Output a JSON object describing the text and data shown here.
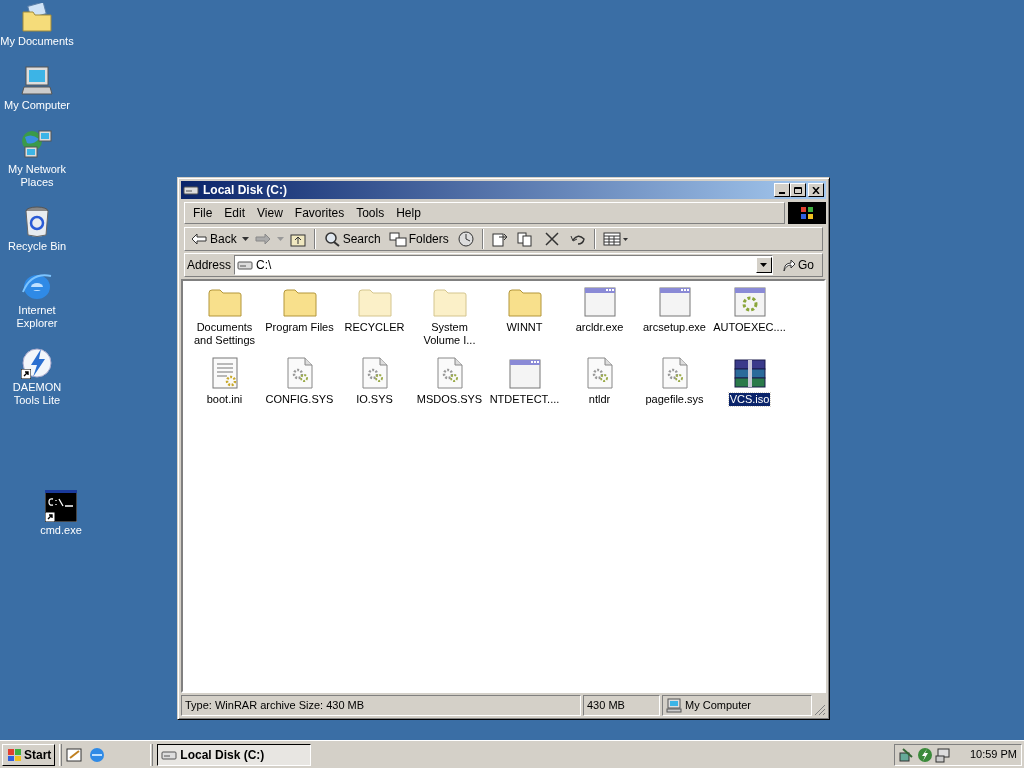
{
  "desktop_icons": [
    {
      "label": "My Documents",
      "kind": "documents"
    },
    {
      "label": "My Computer",
      "kind": "computer"
    },
    {
      "label": "My Network Places",
      "kind": "network"
    },
    {
      "label": "Recycle Bin",
      "kind": "recycle"
    },
    {
      "label": "Internet Explorer",
      "kind": "ie"
    },
    {
      "label": "DAEMON Tools Lite",
      "kind": "daemon",
      "shortcut": true
    }
  ],
  "loose_icon": {
    "label": "cmd.exe",
    "kind": "cmd",
    "shortcut": true
  },
  "window": {
    "title": "Local Disk (C:)",
    "menu": [
      "File",
      "Edit",
      "View",
      "Favorites",
      "Tools",
      "Help"
    ],
    "toolbar": [
      {
        "kind": "back",
        "label": "Back"
      },
      {
        "kind": "forward"
      },
      {
        "kind": "up"
      },
      {
        "kind": "sep"
      },
      {
        "kind": "search",
        "label": "Search"
      },
      {
        "kind": "folders",
        "label": "Folders"
      },
      {
        "kind": "history"
      },
      {
        "kind": "sep"
      },
      {
        "kind": "moveto"
      },
      {
        "kind": "copyto"
      },
      {
        "kind": "delete"
      },
      {
        "kind": "undo"
      },
      {
        "kind": "sep"
      },
      {
        "kind": "views"
      }
    ],
    "address": {
      "label": "Address",
      "value": "C:\\",
      "go": "Go"
    },
    "files": [
      {
        "name": "Documents and Settings",
        "kind": "folder",
        "selected": false
      },
      {
        "name": "Program Files",
        "kind": "folder",
        "selected": false
      },
      {
        "name": "RECYCLER",
        "kind": "hidden-folder",
        "selected": false
      },
      {
        "name": "System Volume I...",
        "kind": "hidden-folder",
        "selected": false
      },
      {
        "name": "WINNT",
        "kind": "folder",
        "selected": false
      },
      {
        "name": "arcldr.exe",
        "kind": "exe",
        "selected": false
      },
      {
        "name": "arcsetup.exe",
        "kind": "exe",
        "selected": false
      },
      {
        "name": "AUTOEXEC....",
        "kind": "sysapp",
        "selected": false
      },
      {
        "name": "boot.ini",
        "kind": "ini",
        "selected": false
      },
      {
        "name": "CONFIG.SYS",
        "kind": "sys",
        "selected": false
      },
      {
        "name": "IO.SYS",
        "kind": "sys",
        "selected": false
      },
      {
        "name": "MSDOS.SYS",
        "kind": "sys",
        "selected": false
      },
      {
        "name": "NTDETECT....",
        "kind": "exe",
        "selected": false
      },
      {
        "name": "ntldr",
        "kind": "sys",
        "selected": false
      },
      {
        "name": "pagefile.sys",
        "kind": "sys",
        "selected": false
      },
      {
        "name": "VCS.iso",
        "kind": "rar",
        "selected": true
      }
    ],
    "status_bar": {
      "info": "Type: WinRAR archive Size: 430 MB",
      "size": "430 MB",
      "zone": "My Computer"
    }
  },
  "taskbar": {
    "start": "Start",
    "tasks": [
      {
        "label": "Local Disk (C:)",
        "selected": true
      }
    ],
    "clock": "10:59 PM"
  }
}
